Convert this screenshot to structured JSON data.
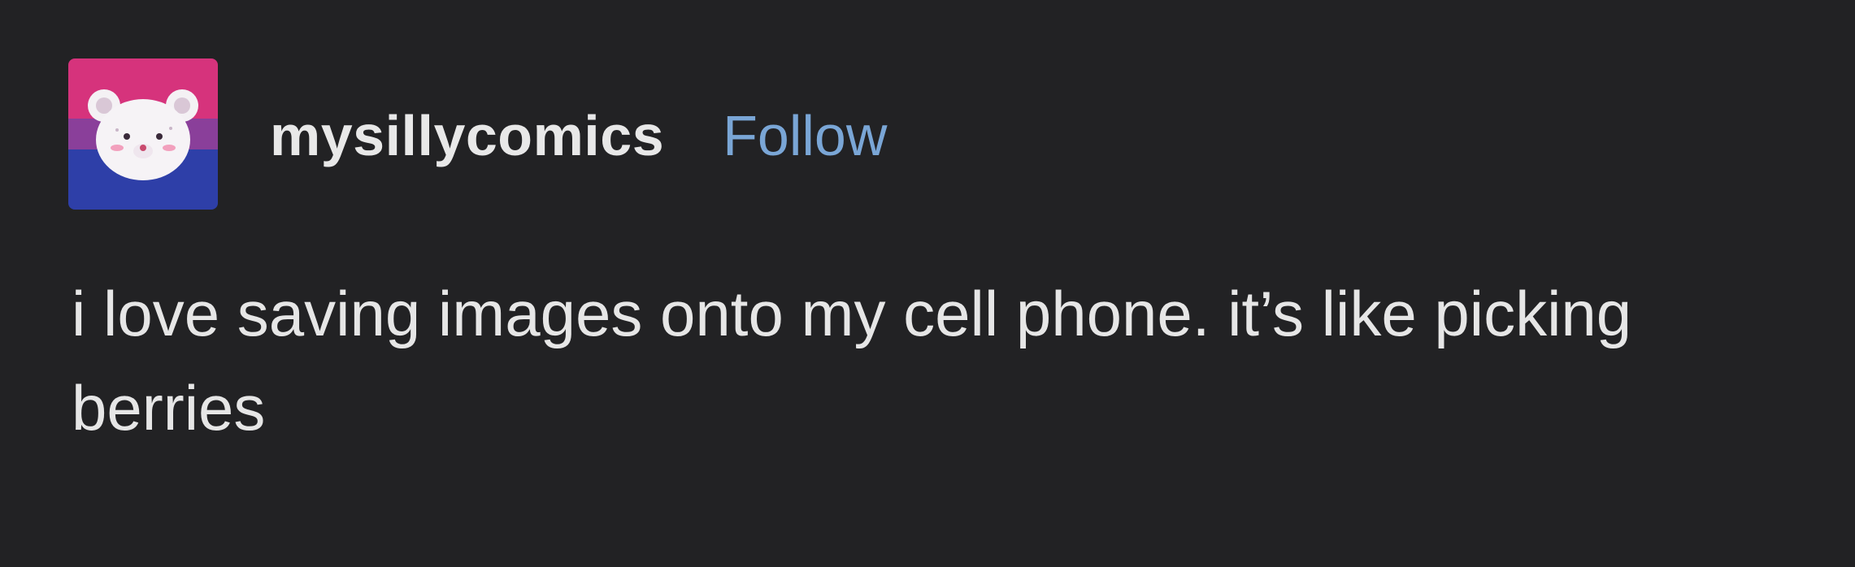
{
  "post": {
    "avatar_icon": "bear-avatar-icon",
    "avatar_colors": {
      "top": "#d6337c",
      "middle": "#8a3f9a",
      "bottom": "#2e3fa8"
    },
    "username": "mysillycomics",
    "follow_label": "Follow",
    "text": "i love saving images onto my cell phone. it’s like picking berries"
  },
  "colors": {
    "background": "#222224",
    "username": "#e8e8e8",
    "follow": "#7aa6d6",
    "text": "#e6e6e6"
  }
}
